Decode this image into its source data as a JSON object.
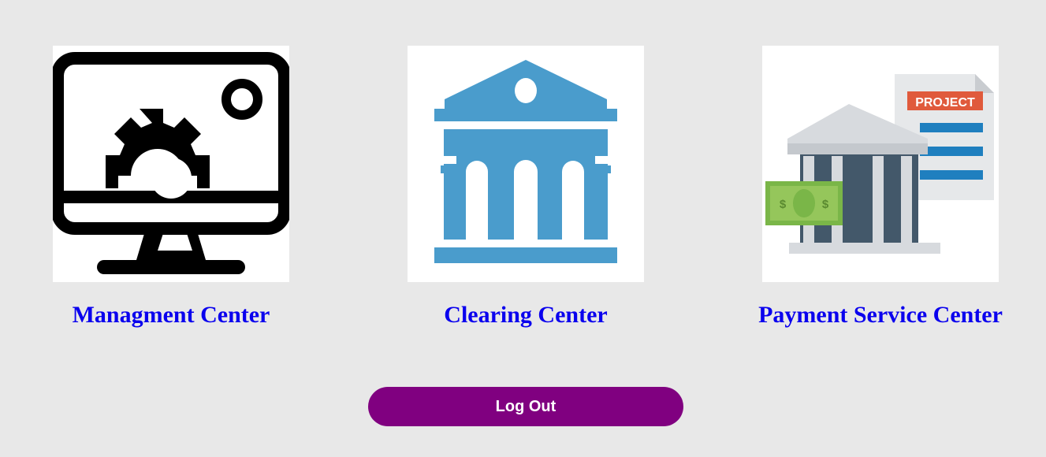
{
  "cards": [
    {
      "label": "Managment Center",
      "icon": "monitor-gear-icon"
    },
    {
      "label": "Clearing Center",
      "icon": "bank-building-icon"
    },
    {
      "label": "Payment Service Center",
      "icon": "bank-payment-project-icon"
    }
  ],
  "project_tag": "PROJECT",
  "currency_symbol": "$",
  "logout_label": "Log Out",
  "colors": {
    "background": "#e8e8e8",
    "link": "#0a00ee",
    "button": "#800080",
    "bank_blue": "#4a9ccc"
  }
}
